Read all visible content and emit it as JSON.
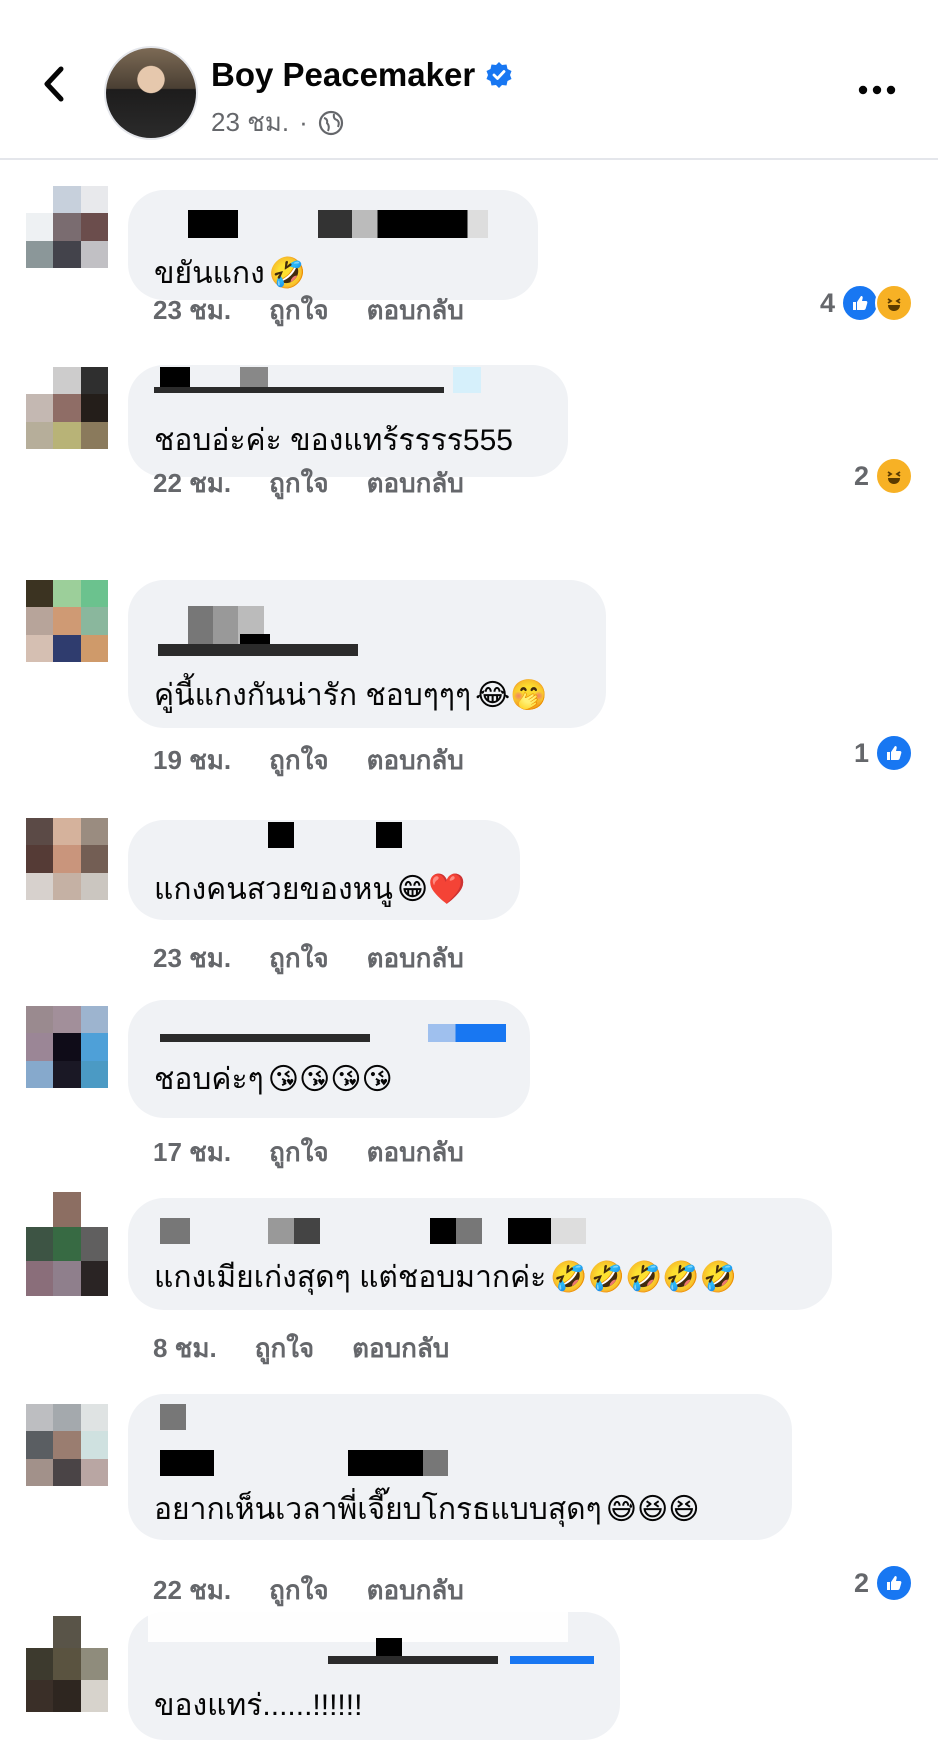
{
  "header": {
    "page_name": "Boy Peacemaker",
    "time": "23 ชม.",
    "separator": "·"
  },
  "actions": {
    "like": "ถูกใจ",
    "reply": "ตอบกลับ"
  },
  "comments": [
    {
      "text": "ขยันแกง",
      "emojis": "🤣",
      "time": "23 ชม.",
      "react_count": "4",
      "reactions": [
        "like",
        "haha"
      ]
    },
    {
      "text": "ชอบอ่ะค่ะ ของแทร้รรรร555",
      "emojis": "",
      "time": "22 ชม.",
      "react_count": "2",
      "reactions": [
        "haha"
      ]
    },
    {
      "text": "คู่นี้แกงกันน่ารัก ชอบๆๆๆ",
      "emojis": "😂🤭",
      "time": "19 ชม.",
      "react_count": "1",
      "reactions": [
        "like"
      ]
    },
    {
      "text": "แกงคนสวยของหนู",
      "emojis": "😁❤️",
      "time": "23 ชม.",
      "react_count": "",
      "reactions": []
    },
    {
      "text": "ชอบค่ะๆ",
      "emojis": "😘😘😘😘",
      "time": "17 ชม.",
      "react_count": "",
      "reactions": []
    },
    {
      "text": "แกงเมียเก่งสุดๆ แต่ชอบมากค่ะ",
      "emojis": "🤣🤣🤣🤣🤣",
      "time": "8 ชม.",
      "react_count": "",
      "reactions": []
    },
    {
      "text": "อยากเห็นเวลาพี่เจี๊ยบโกรธแบบสุดๆ",
      "emojis": "😅😆😆",
      "time": "22 ชม.",
      "react_count": "2",
      "reactions": [
        "like"
      ]
    },
    {
      "text": "ของแทร่......!!!!!!",
      "emojis": "",
      "time": "",
      "react_count": "",
      "reactions": []
    }
  ],
  "colors": {
    "bubble": "#f0f2f5",
    "muted": "#65676b",
    "like_blue": "#1877f2",
    "haha_yellow": "#f7b125"
  }
}
